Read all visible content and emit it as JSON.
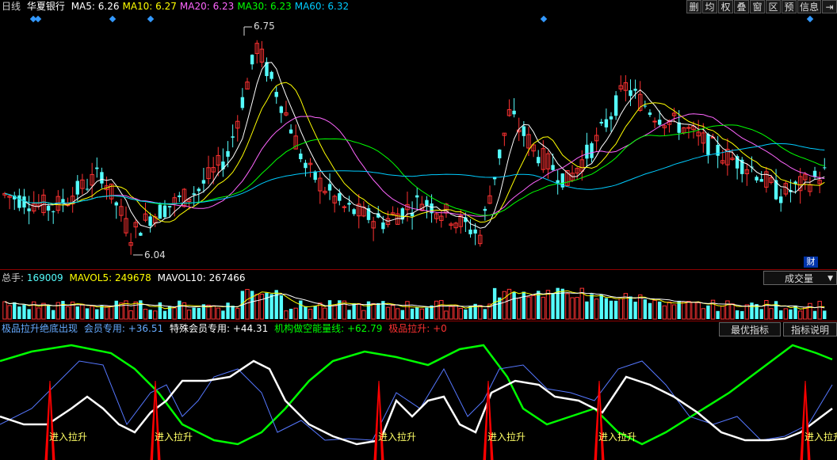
{
  "main": {
    "period": "日线",
    "stock_name": "华夏银行",
    "ma": [
      {
        "label": "MA5:",
        "value": "6.26",
        "color": "#ffffff"
      },
      {
        "label": "MA10:",
        "value": "6.27",
        "color": "#ffff00"
      },
      {
        "label": "MA20:",
        "value": "6.23",
        "color": "#ff66ff"
      },
      {
        "label": "MA30:",
        "value": "6.23",
        "color": "#00ff00"
      },
      {
        "label": "MA60:",
        "value": "6.32",
        "color": "#00ccff"
      }
    ],
    "high_label": "6.75",
    "low_label": "6.04",
    "finance_badge": "财"
  },
  "toolbar": [
    "删",
    "均",
    "权",
    "叠",
    "窗",
    "区",
    "预",
    "信息"
  ],
  "volume": {
    "total_label": "总手:",
    "total_value": "169009",
    "mavol5_label": "MAVOL5:",
    "mavol5_value": "249678",
    "mavol10_label": "MAVOL10:",
    "mavol10_value": "267466",
    "selector": "成交量"
  },
  "indicator": {
    "name": "极品拉升绝底出现",
    "member_label": "会员专用:",
    "member_value": "+36.51",
    "special_label": "特殊会员专用:",
    "special_value": "+44.31",
    "inst_label": "机构做空能量线:",
    "inst_value": "+62.79",
    "up_label": "极品拉升:",
    "up_value": "+0",
    "best_btn": "最优指标",
    "help_btn": "指标说明",
    "signal_text": "进入拉升"
  },
  "colors": {
    "up": "#ff3232",
    "down": "#54fcfc",
    "accent_red": "#8b0000"
  }
}
